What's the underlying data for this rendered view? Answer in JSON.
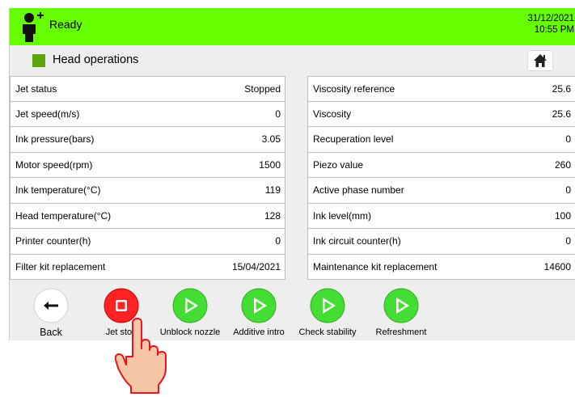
{
  "statusbar": {
    "status": "Ready",
    "date": "31/12/2021",
    "time": "10:55 PM",
    "color": "#66ff00"
  },
  "header": {
    "title": "Head operations",
    "accent": "#5fa30f",
    "home_icon": "home-icon"
  },
  "left_params": [
    {
      "label": "Jet status",
      "value": "Stopped"
    },
    {
      "label": "Jet speed(m/s)",
      "value": "0"
    },
    {
      "label": "Ink pressure(bars)",
      "value": "3.05"
    },
    {
      "label": "Motor speed(rpm)",
      "value": "1500"
    },
    {
      "label": "Ink temperature(°C)",
      "value": "119"
    },
    {
      "label": "Head temperature(°C)",
      "value": "128"
    },
    {
      "label": "Printer counter(h)",
      "value": "0"
    },
    {
      "label": "Filter kit replacement",
      "value": "15/04/2021"
    }
  ],
  "right_params": [
    {
      "label": "Viscosity reference",
      "value": "25.6"
    },
    {
      "label": "Viscosity",
      "value": "25.6"
    },
    {
      "label": "Recuperation level",
      "value": "0"
    },
    {
      "label": "Piezo value",
      "value": "260"
    },
    {
      "label": "Active phase number",
      "value": "0"
    },
    {
      "label": "Ink level(mm)",
      "value": "100"
    },
    {
      "label": "Ink circuit counter(h)",
      "value": "0"
    },
    {
      "label": "Maintenance kit replacement",
      "value": "14600"
    }
  ],
  "toolbar": {
    "back": "Back",
    "jet_stop": "Jet stop",
    "unblock": "Unblock nozzle",
    "additive": "Additive intro",
    "stability": "Check stability",
    "refresh": "Refreshment",
    "stop_color": "#ff2222",
    "play_color": "#44dd33"
  }
}
